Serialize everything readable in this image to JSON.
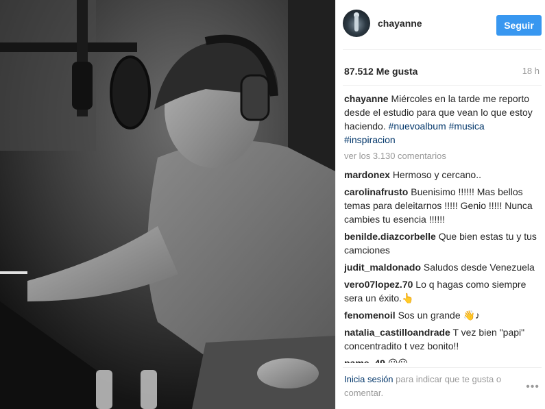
{
  "post": {
    "username": "chayanne",
    "follow_label": "Seguir",
    "likes": "87.512 Me gusta",
    "time_ago": "18 h"
  },
  "caption": {
    "user": "chayanne",
    "text": "Miércoles en la tarde me reporto desde el estudio para que vean lo que estoy haciendo.",
    "tags": [
      "#nuevoalbum",
      "#musica",
      "#inspiracion"
    ]
  },
  "view_more": "ver los 3.130 comentarios",
  "comments": [
    {
      "user": "mardonex",
      "text": "Hermoso y cercano.."
    },
    {
      "user": "carolinafrusto",
      "text": "Buenisimo !!!!!! Mas bellos temas para deleitarnos !!!!! Genio !!!!! Nunca cambies tu esencia !!!!!!"
    },
    {
      "user": "benilde.diazcorbelle",
      "text": "Que bien estas tu y tus camciones"
    },
    {
      "user": "judit_maldonado",
      "text": "Saludos desde Venezuela"
    },
    {
      "user": "vero07lopez.70",
      "text": "Lo q hagas como siempre sera un éxito.👆"
    },
    {
      "user": "fenomenoil",
      "text": "Sos un grande 👋♪"
    },
    {
      "user": "natalia_castilloandrade",
      "text": "T vez bien \"papi\" concentradito t vez bonito!!"
    },
    {
      "user": "pame_49",
      "text": "😶😶"
    }
  ],
  "footer": {
    "login_link": "Inicia sesión",
    "text": "para indicar que te gusta o comentar.",
    "more_icon": "•••"
  }
}
